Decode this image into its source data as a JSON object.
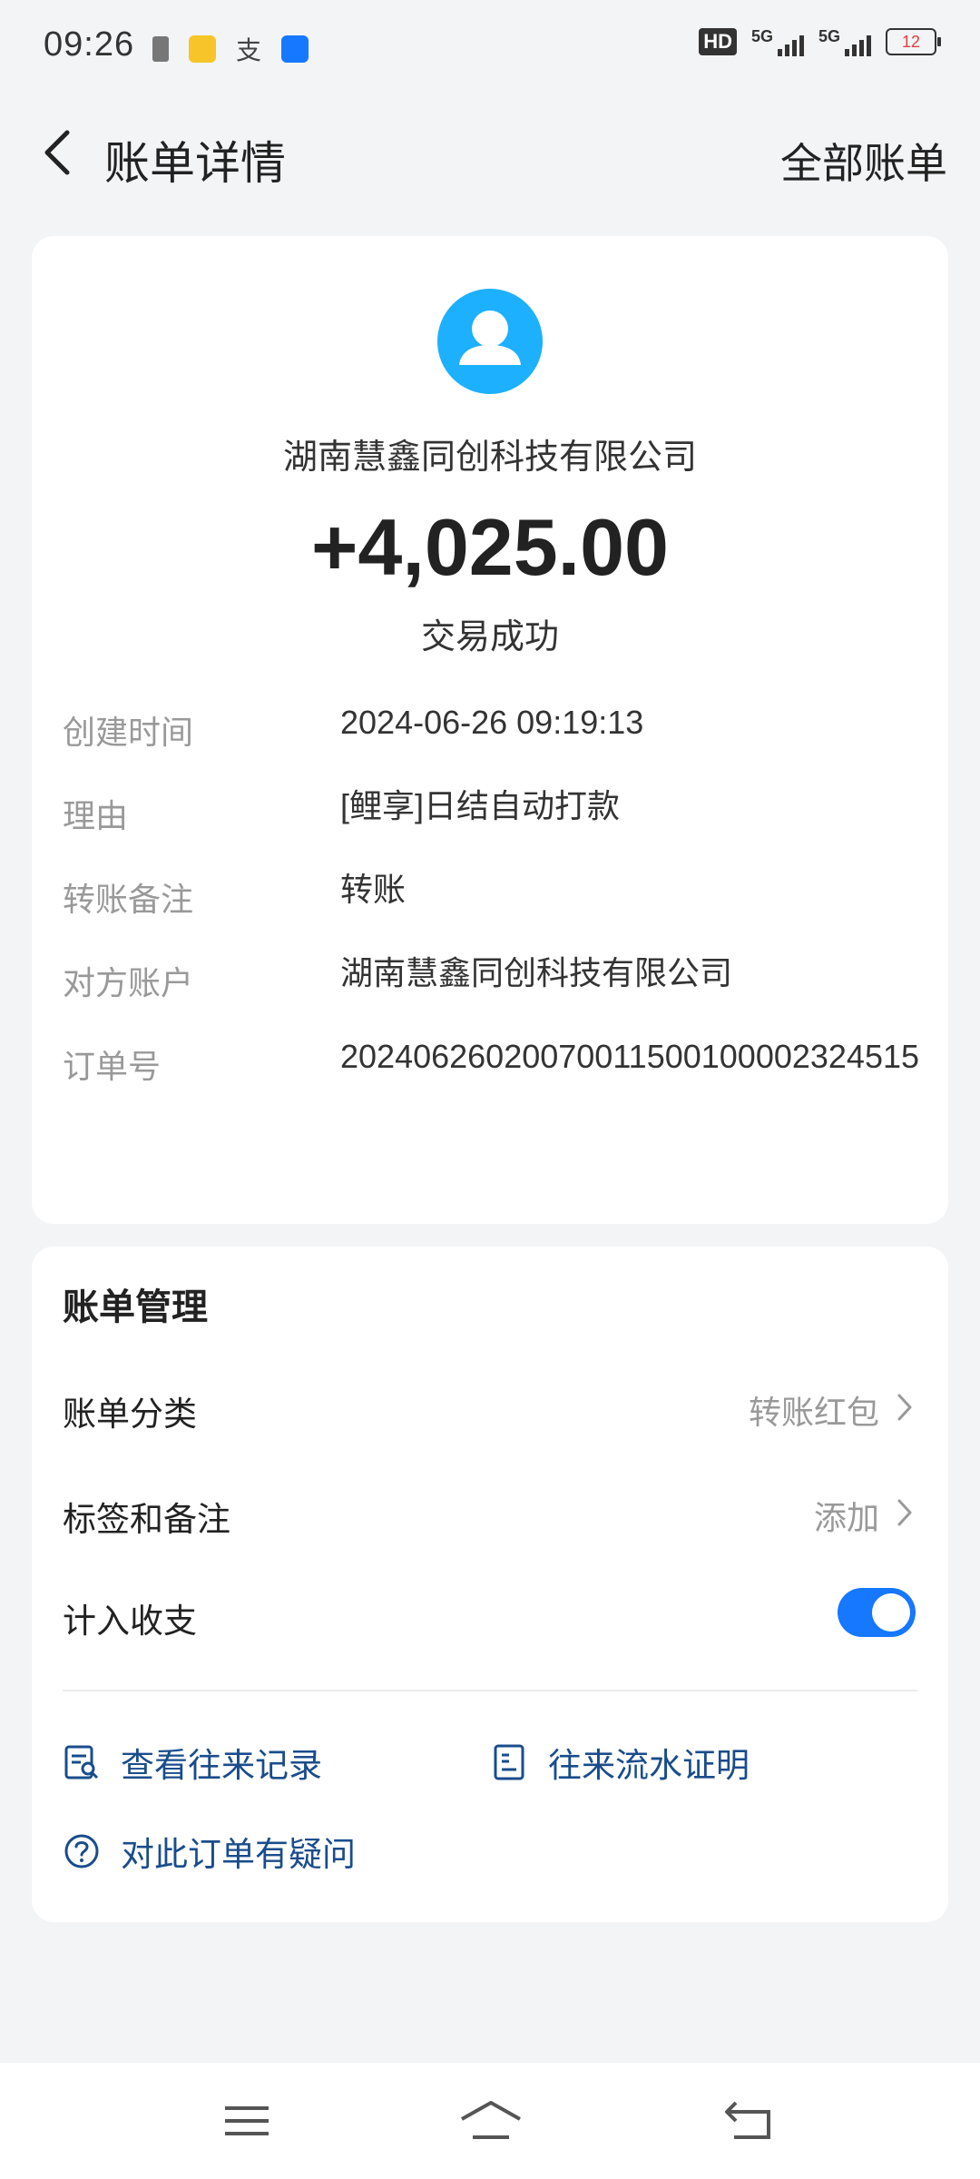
{
  "status_bar": {
    "time": "09:26",
    "hd": "HD",
    "net1": "5G",
    "net2": "5G",
    "battery": "12"
  },
  "header": {
    "title": "账单详情",
    "all_bills": "全部账单"
  },
  "transaction": {
    "payer": "湖南慧鑫同创科技有限公司",
    "amount": "+4,025.00",
    "status": "交易成功",
    "details": [
      {
        "label": "创建时间",
        "value": "2024-06-26 09:19:13"
      },
      {
        "label": "理由",
        "value": "[鲤享]日结自动打款"
      },
      {
        "label": "转账备注",
        "value": "转账"
      },
      {
        "label": "对方账户",
        "value": "湖南慧鑫同创科技有限公司"
      },
      {
        "label": "订单号",
        "value": "20240626020070011500100002324515"
      }
    ]
  },
  "management": {
    "title": "账单管理",
    "category_label": "账单分类",
    "category_value": "转账红包",
    "tags_label": "标签和备注",
    "tags_value": "添加",
    "include_label": "计入收支",
    "include_on": true,
    "link_records": "查看往来记录",
    "link_proof": "往来流水证明",
    "link_question": "对此订单有疑问"
  },
  "colors": {
    "accent": "#1677ff",
    "link": "#1a4c8c",
    "avatar": "#1db0ff"
  },
  "icons": {
    "back": "back-arrow-icon",
    "chevron": "chevron-right-icon",
    "records": "records-search-icon",
    "proof": "document-icon",
    "question": "question-circle-icon",
    "nav_menu": "menu-icon",
    "nav_home": "home-icon",
    "nav_back": "back-icon"
  }
}
